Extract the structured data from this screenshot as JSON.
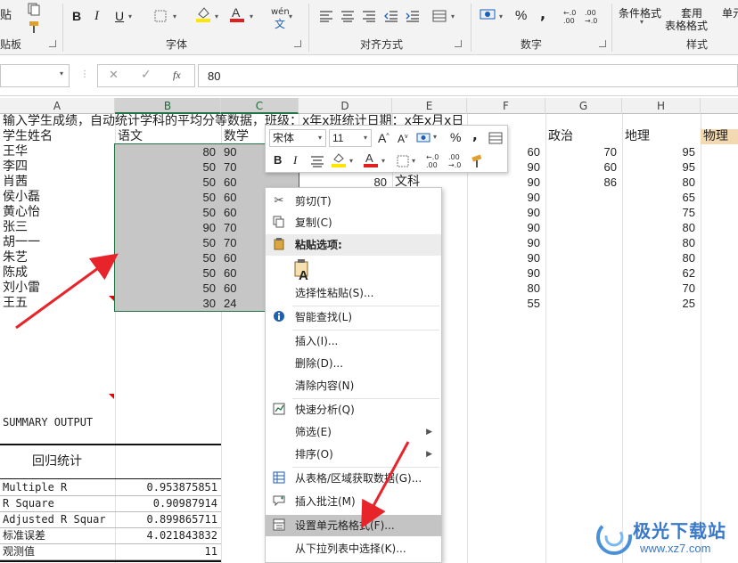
{
  "ribbon": {
    "clipboard_paste": "贴",
    "clipboard_label": "贴板",
    "font_label": "字体",
    "align_label": "对齐方式",
    "number_label": "数字",
    "styles_label": "样式",
    "bold": "B",
    "italic": "I",
    "underline": "U",
    "wen": "wén",
    "percent": "%",
    "comma": ",",
    "cond_format": "条件格式",
    "table_format_1": "套用",
    "table_format_2": "表格格式",
    "cell_styles": "单元"
  },
  "formula_bar": {
    "cancel": "✕",
    "confirm": "✓",
    "fx": "fx",
    "value": "80"
  },
  "columns": [
    "A",
    "B",
    "C",
    "D",
    "E",
    "F",
    "G",
    "H"
  ],
  "sheet": {
    "title_row": "输入学生成绩，自动统计学科的平均分等数据，班级：x年x班统计日期：x年x月x日",
    "headers": {
      "a": "学生姓名",
      "b": "语文",
      "c": "数学",
      "g": "政治",
      "h": "地理",
      "i": "物理"
    },
    "students": [
      {
        "name": "王华",
        "b": "80",
        "c": "90",
        "f": "60",
        "g": "70",
        "h": "95"
      },
      {
        "name": "李四",
        "b": "50",
        "c": "70",
        "f": "90",
        "g": "60",
        "h": "95"
      },
      {
        "name": "肖茜",
        "b": "50",
        "c": "60",
        "f": "90",
        "g": "86",
        "h": "80"
      },
      {
        "name": "侯小磊",
        "b": "50",
        "c": "60",
        "f": "90",
        "g": "",
        "h": "65"
      },
      {
        "name": "黄心怡",
        "b": "50",
        "c": "60",
        "f": "90",
        "g": "",
        "h": "75"
      },
      {
        "name": "张三",
        "b": "90",
        "c": "70",
        "f": "90",
        "g": "",
        "h": "80"
      },
      {
        "name": "胡一一",
        "b": "50",
        "c": "70",
        "f": "90",
        "g": "",
        "h": "80"
      },
      {
        "name": "朱艺",
        "b": "50",
        "c": "60",
        "f": "90",
        "g": "",
        "h": "80"
      },
      {
        "name": "陈成",
        "b": "50",
        "c": "60",
        "f": "90",
        "g": "",
        "h": "62"
      },
      {
        "name": "刘小雷",
        "b": "50",
        "c": "60",
        "f": "80",
        "g": "",
        "h": "70"
      },
      {
        "name": "王五",
        "b": "30",
        "c": "24",
        "f": "55",
        "g": "",
        "h": "25"
      }
    ],
    "d4": "80",
    "e4": "文科",
    "summary_title": "SUMMARY OUTPUT",
    "regression_title": "回归统计",
    "stats": [
      {
        "label": "Multiple R",
        "value": "0.953875851"
      },
      {
        "label": "R Square",
        "value": "0.90987914"
      },
      {
        "label": "Adjusted R Squar",
        "value": "0.899865711"
      },
      {
        "label": "标准误差",
        "value": "4.021843832"
      },
      {
        "label": "观测值",
        "value": "11"
      }
    ]
  },
  "mini_toolbar": {
    "font_name": "宋体",
    "font_size": "11",
    "bold": "B",
    "italic": "I",
    "percent": "%",
    "comma": ","
  },
  "context_menu": {
    "items": [
      {
        "label": "剪切(T)",
        "icon": "scissors-icon"
      },
      {
        "label": "复制(C)",
        "icon": "copy-icon"
      },
      {
        "label": "粘贴选项:",
        "icon": "paste-icon"
      },
      {
        "label": "选择性粘贴(S)...",
        "icon": ""
      },
      {
        "label": "智能查找(L)",
        "icon": "smart-lookup-icon"
      },
      {
        "label": "插入(I)...",
        "icon": ""
      },
      {
        "label": "删除(D)...",
        "icon": ""
      },
      {
        "label": "清除内容(N)",
        "icon": ""
      },
      {
        "label": "快速分析(Q)",
        "icon": "quick-analysis-icon"
      },
      {
        "label": "筛选(E)",
        "icon": ""
      },
      {
        "label": "排序(O)",
        "icon": ""
      },
      {
        "label": "从表格/区域获取数据(G)...",
        "icon": "table-icon"
      },
      {
        "label": "插入批注(M)",
        "icon": "comment-icon"
      },
      {
        "label": "设置单元格格式(F)...",
        "icon": "format-cells-icon"
      },
      {
        "label": "从下拉列表中选择(K)...",
        "icon": ""
      }
    ]
  },
  "watermark": {
    "brand": "极光下载站",
    "url": "www.xz7.com"
  },
  "colors": {
    "selection": "#c6c6c6",
    "excel_green": "#217346",
    "arrow_red": "#e8242b"
  }
}
